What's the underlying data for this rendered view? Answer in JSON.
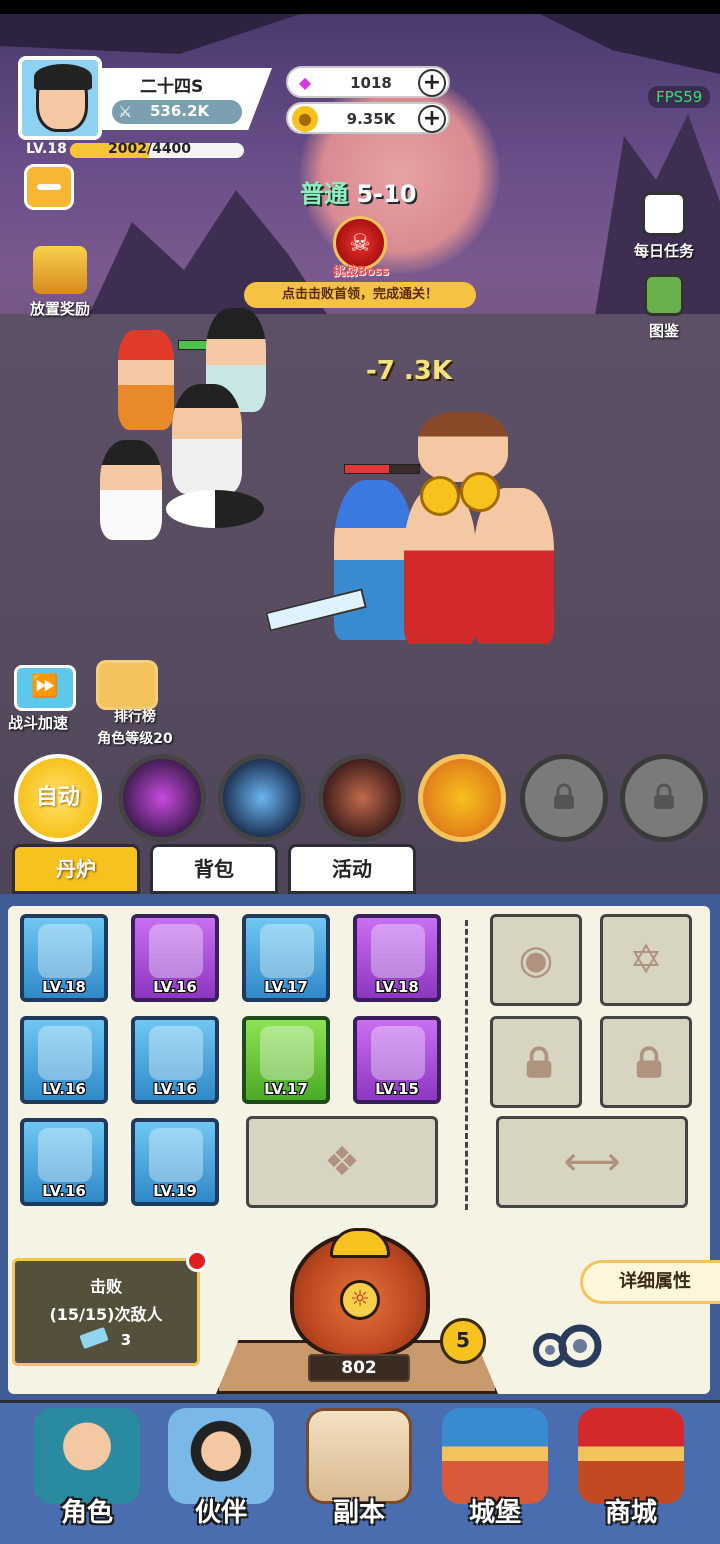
{
  "hud": {
    "player_name": "二十四S",
    "power": "536.2K",
    "level_label": "LV.18",
    "xp_current": 2002,
    "xp_max": 4400,
    "xp_text": "2002/4400",
    "fps": "FPS59"
  },
  "currency": {
    "gems": "1018",
    "gold": "9.35K"
  },
  "stage": {
    "mode": "普通",
    "number": "5-10",
    "boss_label": "挑战Boss",
    "boss_tip": "点击击败首领，完成通关！"
  },
  "side": {
    "idle_reward": "放置奖励",
    "daily_task": "每日任务",
    "codex": "图鉴",
    "speed": "战斗加速",
    "ranking": "排行榜",
    "ranking_sub": "角色等级20"
  },
  "battle": {
    "damage_text": "-7 .3K",
    "ally_hp": 0.72,
    "enemy_hp": 0.6
  },
  "skills": {
    "auto_label": "自动"
  },
  "tabs": [
    "丹炉",
    "背包",
    "活动"
  ],
  "equipment": [
    {
      "level": "LV.18",
      "rarity": "blue",
      "icon": "spear-icon"
    },
    {
      "level": "LV.16",
      "rarity": "purple",
      "icon": "gauntlet-icon"
    },
    {
      "level": "LV.17",
      "rarity": "blue",
      "icon": "robe-icon"
    },
    {
      "level": "LV.18",
      "rarity": "purple",
      "icon": "phoenix-orb-icon"
    },
    {
      "level": "LV.16",
      "rarity": "blue",
      "icon": "staff-icon"
    },
    {
      "level": "LV.16",
      "rarity": "blue",
      "icon": "jade-pendant-icon"
    },
    {
      "level": "LV.17",
      "rarity": "green",
      "icon": "gourd-icon"
    },
    {
      "level": "LV.15",
      "rarity": "purple",
      "icon": "fire-orb-icon"
    },
    {
      "level": "LV.16",
      "rarity": "blue",
      "icon": "belt-icon"
    },
    {
      "level": "LV.19",
      "rarity": "blue",
      "icon": "boots-icon"
    }
  ],
  "defeat": {
    "title": "击败",
    "progress": "(15/15)次敌人",
    "tickets": "3"
  },
  "furnace": {
    "count": "802",
    "badge": "5"
  },
  "detail_button": "详细属性",
  "nav": [
    "角色",
    "伙伴",
    "副本",
    "城堡",
    "商城"
  ],
  "colors": {
    "accent": "#f7c21e",
    "panel_bg": "#3f5c97",
    "panel_inner": "#f5f3e3",
    "rarity_blue": "#2f89c8",
    "rarity_purple": "#8d36c2",
    "rarity_green": "#4bab25"
  }
}
